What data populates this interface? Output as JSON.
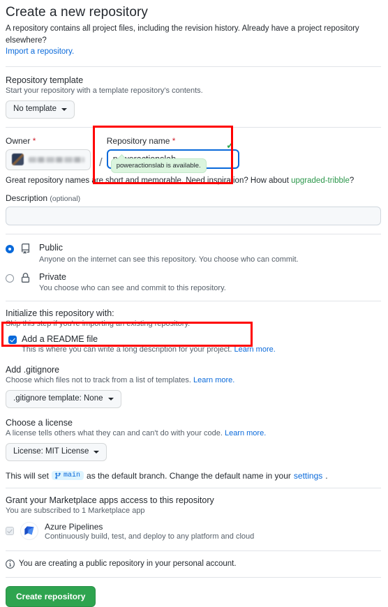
{
  "header": {
    "title": "Create a new repository",
    "description": "A repository contains all project files, including the revision history. Already have a project repository elsewhere?",
    "import_link": "Import a repository."
  },
  "template_section": {
    "title": "Repository template",
    "subtitle": "Start your repository with a template repository's contents.",
    "button_label": "No template"
  },
  "owner_section": {
    "owner_label": "Owner",
    "required_mark": "*",
    "owner_value": "",
    "separator": "/",
    "name_label": "Repository name",
    "name_value": "poweractionslab",
    "availability_tooltip": "poweractionslab is available.",
    "check_icon": "✓",
    "helper_prefix": "Great repository names are short and memorable. Need inspiration? How about ",
    "helper_suggestion": "upgraded-tribble",
    "helper_suffix": "?"
  },
  "description_section": {
    "label": "Description",
    "optional": "(optional)",
    "value": "",
    "placeholder": ""
  },
  "visibility": {
    "options": [
      {
        "title": "Public",
        "description": "Anyone on the internet can see this repository. You choose who can commit.",
        "selected": true,
        "icon": "repo-icon"
      },
      {
        "title": "Private",
        "description": "You choose who can see and commit to this repository.",
        "selected": false,
        "icon": "lock-icon"
      }
    ]
  },
  "initialize": {
    "title": "Initialize this repository with:",
    "subtitle": "Skip this step if you're importing an existing repository.",
    "readme": {
      "label": "Add a README file",
      "description": "This is where you can write a long description for your project.",
      "learn_more": "Learn more.",
      "checked": true
    }
  },
  "gitignore": {
    "title": "Add .gitignore",
    "subtitle": "Choose which files not to track from a list of templates.",
    "learn_more": "Learn more.",
    "button_label": ".gitignore template: None"
  },
  "license": {
    "title": "Choose a license",
    "subtitle": "A license tells others what they can and can't do with your code.",
    "learn_more": "Learn more.",
    "button_label": "License: MIT License"
  },
  "branch_notice": {
    "prefix": "This will set",
    "branch_name": "main",
    "middle": "as the default branch. Change the default name in your",
    "settings_link": "settings",
    "suffix": "."
  },
  "marketplace": {
    "title": "Grant your Marketplace apps access to this repository",
    "subtitle": "You are subscribed to 1 Marketplace app",
    "apps": [
      {
        "name": "Azure Pipelines",
        "description": "Continuously build, test, and deploy to any platform and cloud",
        "checked": true,
        "disabled": true,
        "icon": "azure-pipelines-icon"
      }
    ]
  },
  "footer": {
    "notice_icon": "info-icon",
    "notice": "You are creating a public repository in your personal account.",
    "create_button": "Create repository"
  },
  "annotations": {
    "accent_red": "#ff0000",
    "boxes": [
      "repository-name-field",
      "add-readme-checkbox"
    ]
  }
}
